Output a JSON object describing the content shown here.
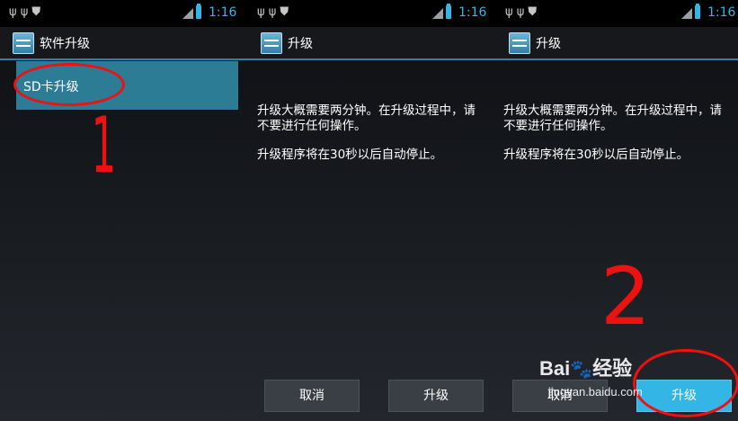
{
  "status_bar": {
    "usb_icons": "ψ ψ ⛊",
    "time": "1:16"
  },
  "panels": [
    {
      "title": "软件升级",
      "list_item": "SD卡升级"
    },
    {
      "title": "升级",
      "message1": "升级大概需要两分钟。在升级过程中，请不要进行任何操作。",
      "message2": "升级程序将在30秒以后自动停止。",
      "cancel_label": "取消",
      "upgrade_label": "升级"
    },
    {
      "title": "升级",
      "message1": "升级大概需要两分钟。在升级过程中，请不要进行任何操作。",
      "message2": "升级程序将在30秒以后自动停止。",
      "cancel_label": "取消",
      "upgrade_label": "升级"
    }
  ],
  "annotations": {
    "step1": "1",
    "step2": "2"
  },
  "watermark": {
    "brand": "Bai",
    "brand2": "经验",
    "url": "jingyan.baidu.com"
  },
  "colors": {
    "accent": "#33b5e5",
    "highlight": "#2c7c96",
    "annotation": "#ee1111"
  }
}
